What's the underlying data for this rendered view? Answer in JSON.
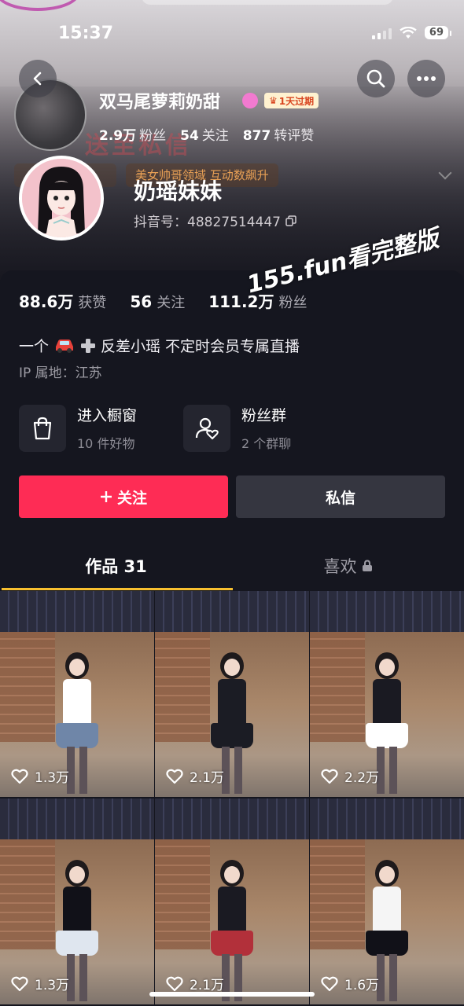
{
  "status_bar": {
    "time": "15:37",
    "battery": "69"
  },
  "background_profile": {
    "name": "双马尾萝莉奶甜",
    "vip_badge": "1天过期",
    "watermark": "送至私信",
    "stats": [
      {
        "value": "2.9万",
        "label": "粉丝"
      },
      {
        "value": "54",
        "label": "关注"
      },
      {
        "value": "877",
        "label": "转评赞"
      }
    ],
    "tag": "美女帅哥领域 互动数飙升"
  },
  "profile": {
    "name": "奶瑶妹妹",
    "douyin_id": "抖音号：48827514447"
  },
  "overlay_watermark": "155.fun看完整版",
  "stats": [
    {
      "value": "88.6万",
      "label": "获赞"
    },
    {
      "value": "56",
      "label": "关注"
    },
    {
      "value": "111.2万",
      "label": "粉丝"
    }
  ],
  "bio": {
    "prefix": "一个",
    "text": "反差小瑶 不定时会员专属直播"
  },
  "ip": "IP 属地：江苏",
  "entries": [
    {
      "title": "进入橱窗",
      "subtitle": "10 件好物",
      "icon": "shopping-bag-icon"
    },
    {
      "title": "粉丝群",
      "subtitle": "2 个群聊",
      "icon": "fan-group-icon"
    }
  ],
  "buttons": {
    "follow": "关注",
    "message": "私信"
  },
  "tabs": {
    "works": "作品 31",
    "likes": "喜欢"
  },
  "videos": [
    {
      "likes": "1.3万",
      "outfit": "#ffffff",
      "skirt": "#6f86a8",
      "head": "#f3b8a8"
    },
    {
      "likes": "2.1万",
      "outfit": "#1b1c24",
      "skirt": "#1b1c24",
      "head": "#1e1a1c"
    },
    {
      "likes": "2.2万",
      "outfit": "#1a1a22",
      "skirt": "#ffffff",
      "head": "#1e1a1c"
    },
    {
      "likes": "1.3万",
      "outfit": "#111118",
      "skirt": "#dfe6ef",
      "head": "#1e1a1c"
    },
    {
      "likes": "2.1万",
      "outfit": "#1a1a22",
      "skirt": "#b2303a",
      "head": "#1e1a1c"
    },
    {
      "likes": "1.6万",
      "outfit": "#f5f5f5",
      "skirt": "#111118",
      "head": "#1e1a1c"
    }
  ],
  "colors": {
    "accent": "#fe2c55",
    "tab_indicator": "#f8c02f",
    "card_bg": "#15161f"
  }
}
